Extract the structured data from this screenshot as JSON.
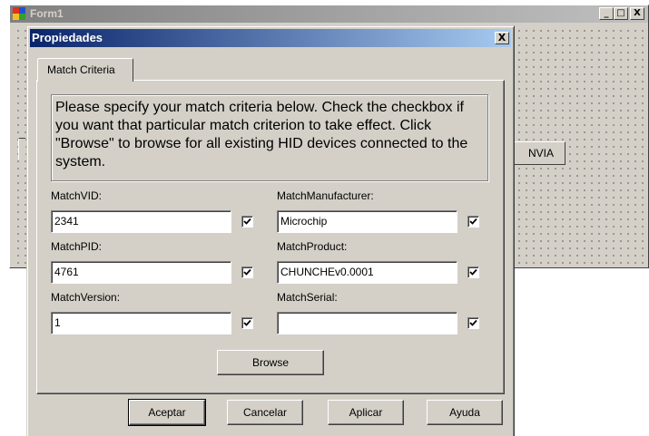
{
  "background_form": {
    "title": "Form1",
    "minimize_label": "_",
    "maximize_label": "□",
    "close_label": "X",
    "partial_button_label": "NVIA"
  },
  "dialog": {
    "title": "Propiedades",
    "close_label": "X",
    "tab_label": "Match Criteria",
    "info_text": "Please specify your match criteria below.  Check the checkbox if you want that particular match criterion to take effect.  Click \"Browse\" to browse for all existing HID devices connected to the system.",
    "fields": {
      "vid": {
        "label": "MatchVID:",
        "value": "2341",
        "checked": true
      },
      "pid": {
        "label": "MatchPID:",
        "value": "4761",
        "checked": true
      },
      "version": {
        "label": "MatchVersion:",
        "value": "1",
        "checked": true
      },
      "manufacturer": {
        "label": "MatchManufacturer:",
        "value": "Microchip",
        "checked": true
      },
      "product": {
        "label": "MatchProduct:",
        "value": "CHUNCHEv0.0001",
        "checked": true
      },
      "serial": {
        "label": "MatchSerial:",
        "value": "",
        "checked": true
      }
    },
    "browse_label": "Browse",
    "buttons": {
      "accept": "Aceptar",
      "cancel": "Cancelar",
      "apply": "Aplicar",
      "help": "Ayuda"
    }
  },
  "colors": {
    "face": "#d4d0c8",
    "active_title_start": "#0a246a",
    "active_title_end": "#a6caf0",
    "inactive_title": "#808080"
  }
}
